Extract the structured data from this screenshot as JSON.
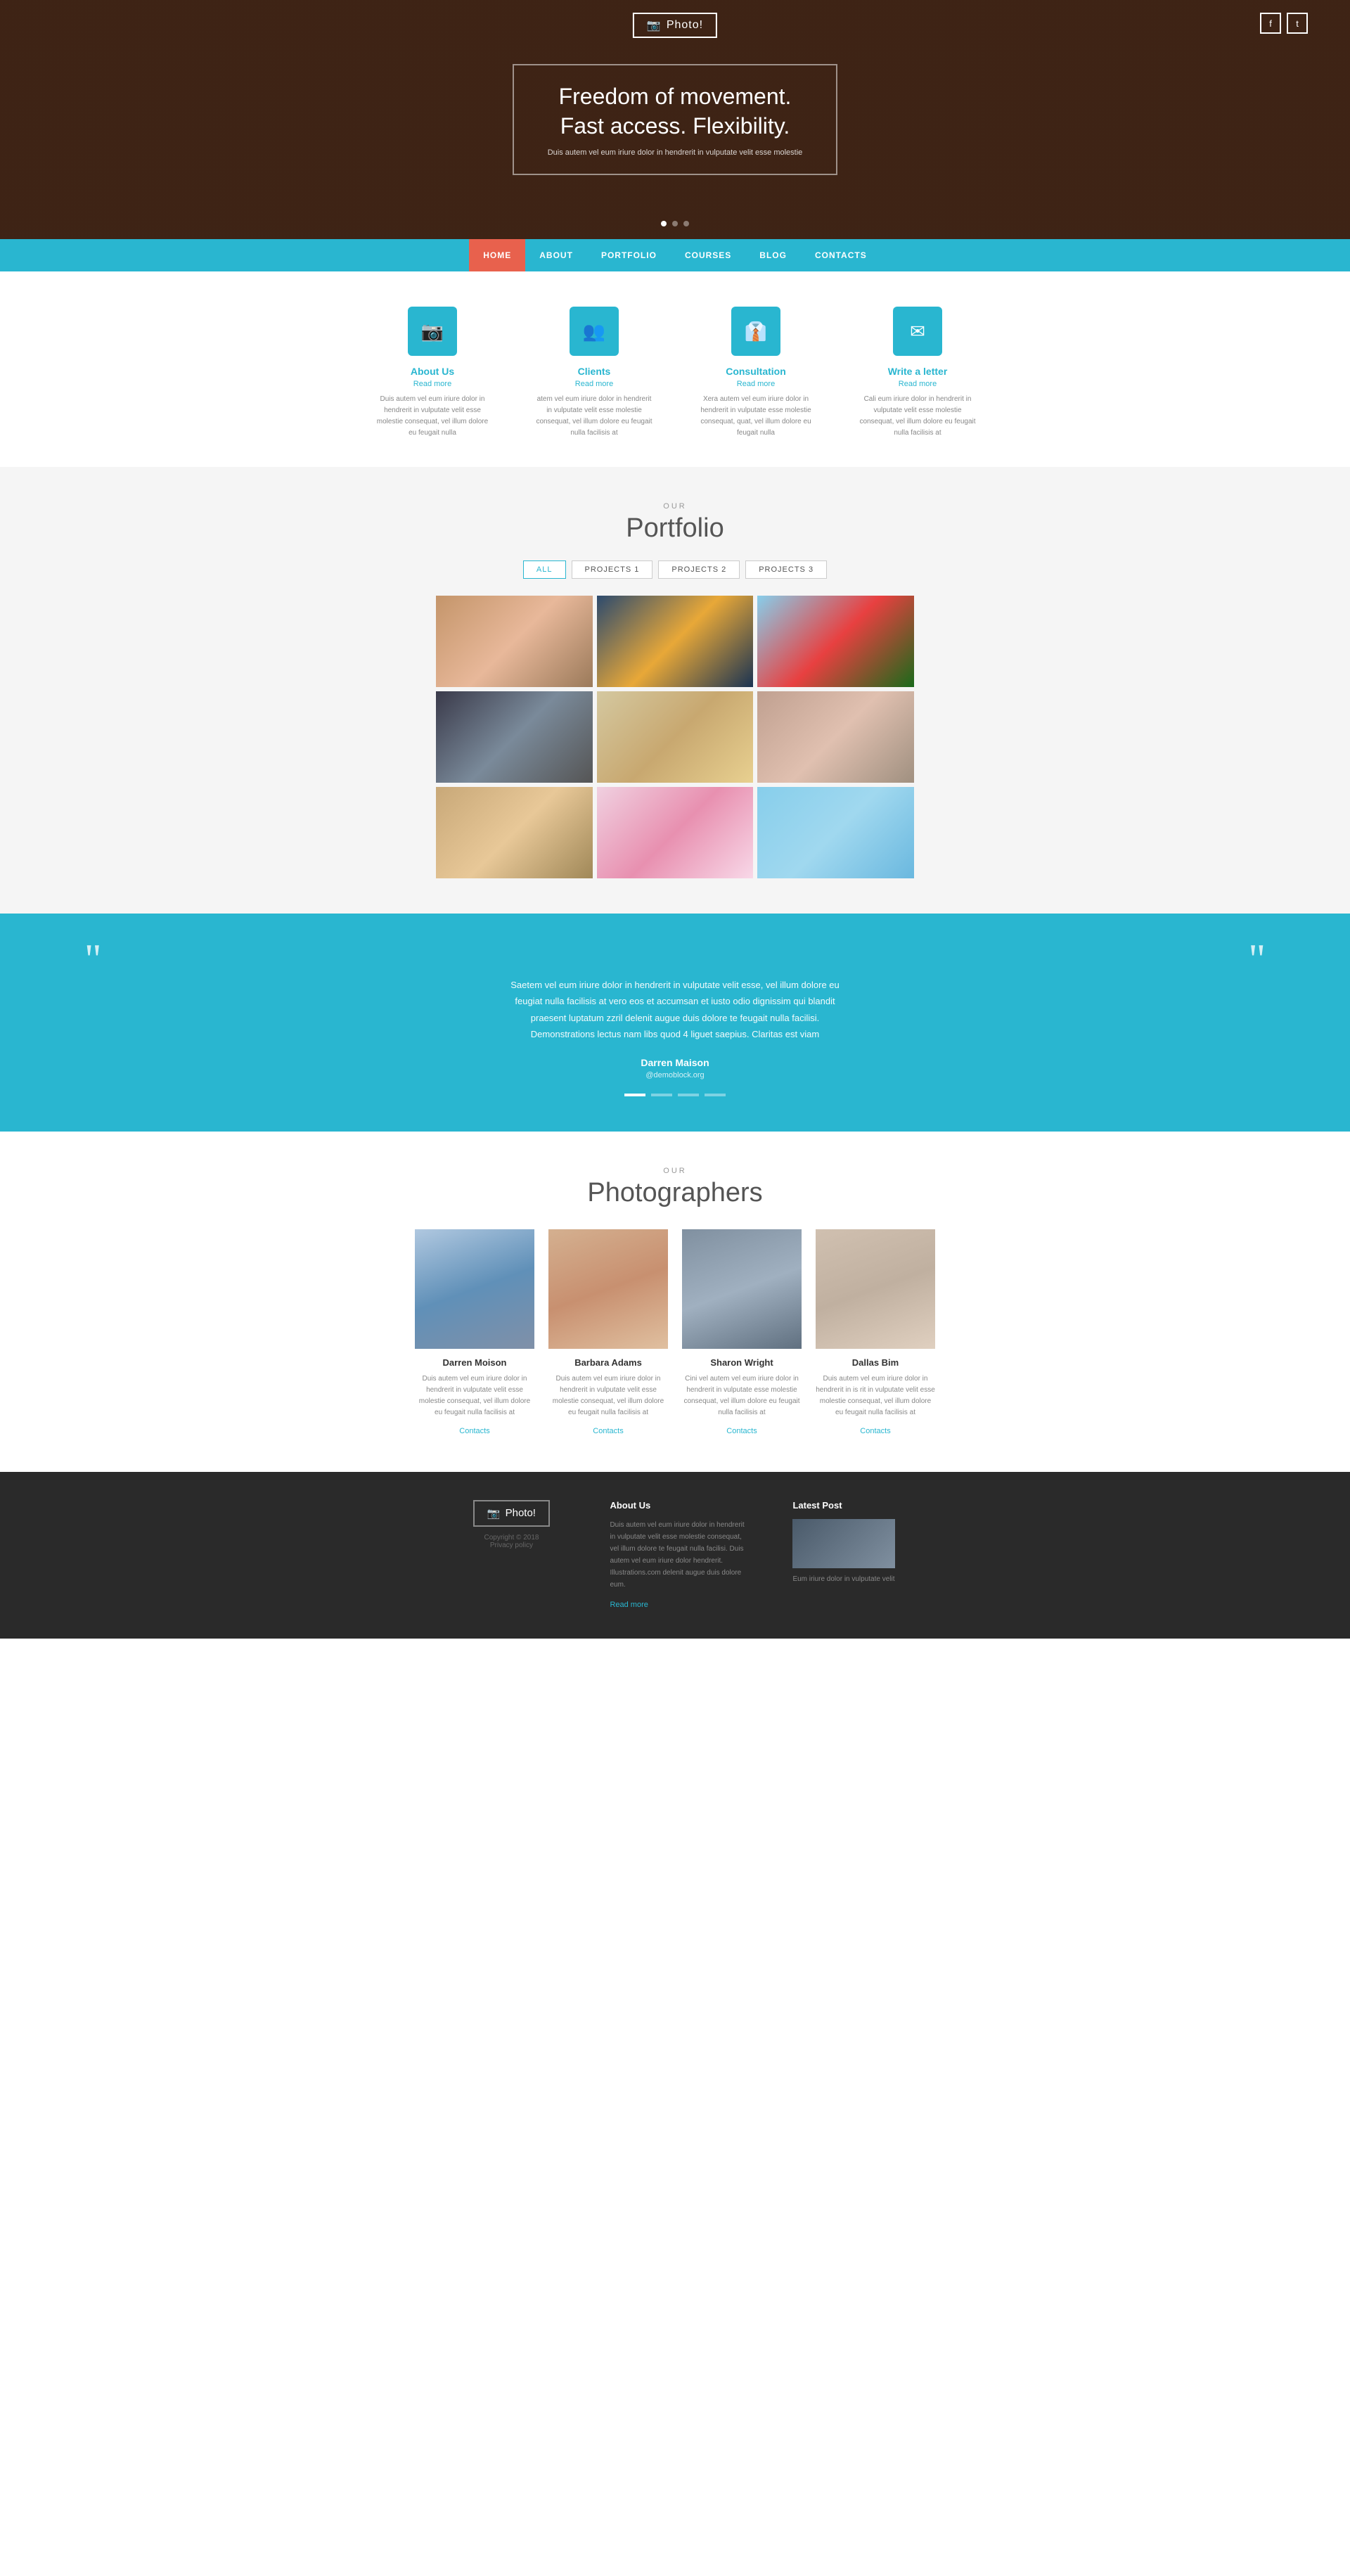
{
  "hero": {
    "logo": "Photo!",
    "headline_line1": "Freedom of movement.",
    "headline_line2": "Fast access. Flexibility.",
    "subtext": "Duis autem vel eum iriure dolor in hendrerit in vulputate velit esse molestie",
    "dots": [
      true,
      false,
      false
    ]
  },
  "nav": {
    "items": [
      {
        "label": "HOME",
        "active": true
      },
      {
        "label": "ABOUT",
        "active": false
      },
      {
        "label": "PORTFOLIO",
        "active": false
      },
      {
        "label": "COURSES",
        "active": false
      },
      {
        "label": "BLOG",
        "active": false
      },
      {
        "label": "CONTACTS",
        "active": false
      }
    ]
  },
  "features": {
    "items": [
      {
        "icon": "📷",
        "title": "About Us",
        "readmore": "Read more",
        "desc": "Duis autem vel eum iriure dolor in hendrerit in vulputate velit esse molestie consequat, vel illum dolore eu feugait nulla"
      },
      {
        "icon": "👥",
        "title": "Clients",
        "readmore": "Read more",
        "desc": "atem vel eum iriure dolor in hendrerit in vulputate velit esse molestie consequat, vel illum dolore eu feugait nulla facilisis at"
      },
      {
        "icon": "👔",
        "title": "Consultation",
        "readmore": "Read more",
        "desc": "Xera autem vel eum iriure dolor in hendrerit in vulputate esse molestie consequat, quat, vel illum dolore eu feugait nulla"
      },
      {
        "icon": "✉️",
        "title": "Write a letter",
        "readmore": "Read more",
        "desc": "Cali eum iriure dolor in hendrerit in vulputate velit esse molestie consequat, vel illum dolore eu feugait nulla facilisis at"
      }
    ]
  },
  "portfolio": {
    "label": "OUR",
    "title": "Portfolio",
    "filters": [
      "ALL",
      "PROJECTS 1",
      "PROJECTS 2",
      "PROJECTS 3"
    ],
    "active_filter": "ALL",
    "images": [
      {
        "class": "pi-1",
        "alt": "Portrait woman"
      },
      {
        "class": "pi-2",
        "alt": "Landscape sunset rocks"
      },
      {
        "class": "pi-3",
        "alt": "Silhouette flowers sky"
      },
      {
        "class": "pi-4",
        "alt": "Couple motorcycle"
      },
      {
        "class": "pi-5",
        "alt": "Woman hair wind"
      },
      {
        "class": "pi-6",
        "alt": "Woman sitting pose"
      },
      {
        "class": "pi-7",
        "alt": "Woman profile wind"
      },
      {
        "class": "pi-8",
        "alt": "Child umbrella"
      },
      {
        "class": "pi-9",
        "alt": "Woman hat sunglasses"
      }
    ]
  },
  "testimonial": {
    "text": "Saetem vel eum iriure dolor in hendrerit in vulputate velit esse, vel illum dolore eu feugiat nulla facilisis at vero eos et accumsan et iusto odio dignissim qui blandit praesent luptatum zzril delenit augue duis dolore te feugait nulla facilisi. Demonstrations lectus nam libs quod 4 liguet saepius. Claritas est viam",
    "author": "Darren Maison",
    "handle": "@demoblock.org",
    "dots": [
      true,
      false,
      false,
      false
    ]
  },
  "photographers": {
    "label": "OUR",
    "title": "Photographers",
    "items": [
      {
        "name": "Darren Moison",
        "photo_class": "ph-1",
        "desc": "Duis autem vel eum iriure dolor in hendrerit in vulputate velit esse molestie consequat, vel illum dolore eu feugait nulla facilisis at",
        "link": "Contacts"
      },
      {
        "name": "Barbara Adams",
        "photo_class": "ph-2",
        "desc": "Duis autem vel eum iriure dolor in hendrerit in vulputate velit esse molestie consequat, vel illum dolore eu feugait nulla facilisis at",
        "link": "Contacts"
      },
      {
        "name": "Sharon Wright",
        "photo_class": "ph-3",
        "desc": "Cini vel autem vel eum iriure dolor in hendrerit in vulputate esse molestie consequat, vel illum dolore eu feugait nulla facilisis at",
        "link": "Contacts"
      },
      {
        "name": "Dallas Bim",
        "photo_class": "ph-4",
        "desc": "Duis autem vel eum iriure dolor in hendrerit in is rit in vulputate velit esse molestie consequat, vel illum dolore eu feugait nulla facilisis at",
        "link": "Contacts"
      }
    ]
  },
  "footer": {
    "logo": "Photo!",
    "copyright": "Copyright © 2018",
    "privacy": "Privacy policy",
    "about": {
      "title": "About Us",
      "text": "Duis autem vel eum iriure dolor in hendrerit in vulputate velit esse molestie consequat, vel illum dolore te feugait nulla facilisi. Duis autem vel eum iriure dolor hendrerit. Illustrations.com delenit augue duis dolore eum.",
      "readmore": "Read more"
    },
    "latest_post": {
      "title": "Latest Post",
      "text": "Eum iriure dolor in vulputate velit"
    }
  },
  "icons": {
    "camera": "📷",
    "facebook": "f",
    "twitter": "t",
    "users": "👥",
    "tie": "👔",
    "mail": "✉"
  }
}
